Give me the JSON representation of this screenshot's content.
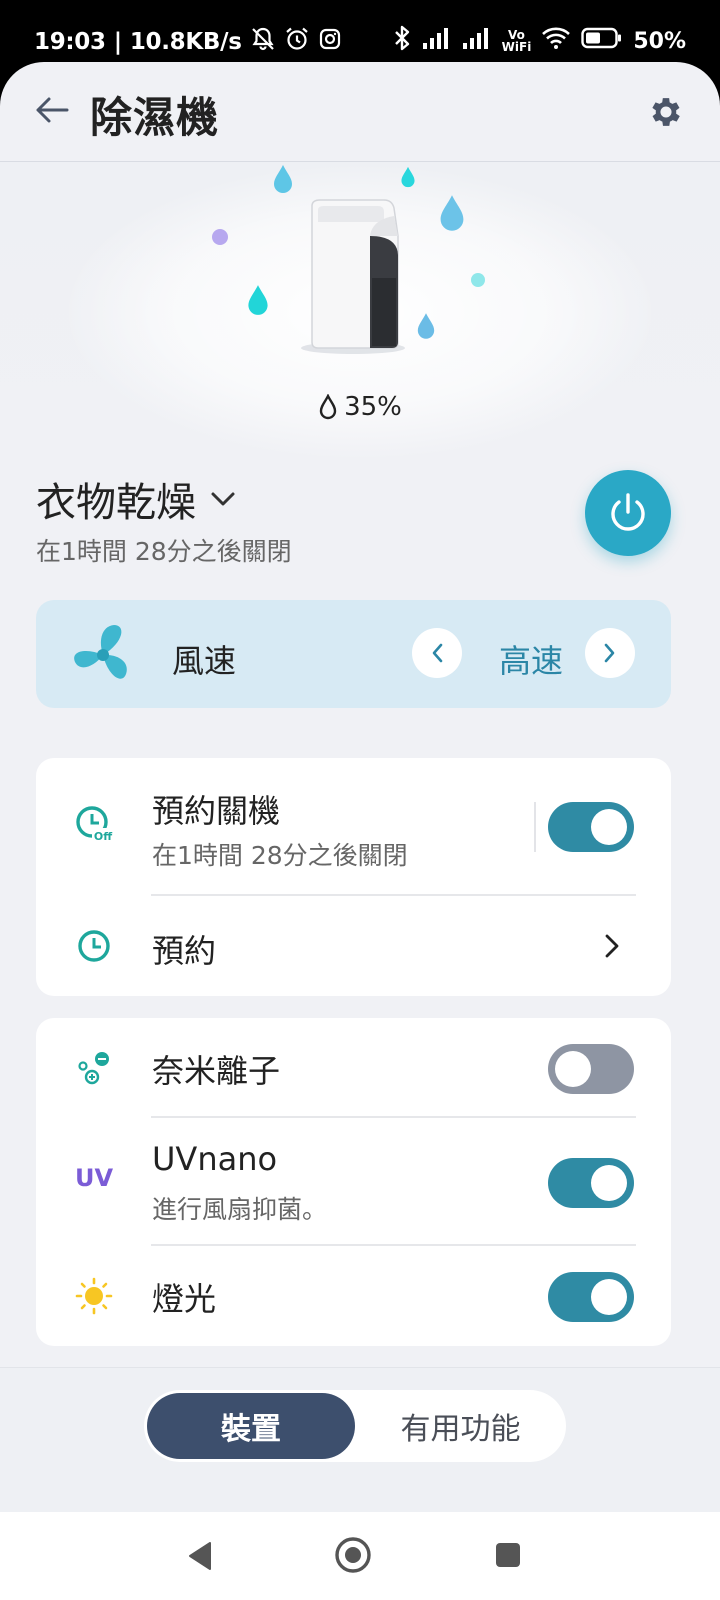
{
  "status_bar": {
    "time": "19:03",
    "separator": "|",
    "net_speed": "10.8KB/s",
    "battery": "50%",
    "icons": [
      "muted-bell-icon",
      "alarm-icon",
      "instagram-icon",
      "bluetooth-icon",
      "signal-icon",
      "signal-icon",
      "vowifi-icon",
      "wifi-icon",
      "battery-icon"
    ],
    "vowifi_top": "Vo",
    "vowifi_bottom": "WiFi"
  },
  "header": {
    "title": "除濕機",
    "back_icon": "arrow-left-icon",
    "settings_icon": "gear-icon"
  },
  "hero": {
    "humidity": "35%",
    "humidity_icon": "droplet-icon"
  },
  "mode": {
    "name": "衣物乾燥",
    "subtitle": "在1時間 28分之後關閉",
    "power_color": "#2aa8c6"
  },
  "fan": {
    "label": "風速",
    "value": "高速",
    "icon": "fan-icon"
  },
  "schedule_card": {
    "rows": [
      {
        "title": "預約關機",
        "subtitle": "在1時間 28分之後關閉",
        "icon": "timer-off-icon",
        "toggle": true
      },
      {
        "title": "預約",
        "icon": "timer-icon"
      }
    ]
  },
  "features_card": {
    "rows": [
      {
        "title": "奈米離子",
        "icon": "ion-icon",
        "toggle": false
      },
      {
        "title": "UVnano",
        "subtitle": "進行風扇抑菌。",
        "icon": "uv-icon",
        "icon_text": "UV",
        "toggle": true
      },
      {
        "title": "燈光",
        "icon": "light-icon",
        "toggle": true
      }
    ]
  },
  "tabs": {
    "active": "裝置",
    "inactive": "有用功能"
  },
  "colors": {
    "accent": "#2f8ba4",
    "toggle_off": "#8e95a3",
    "tab_active": "#3d4f6d",
    "fan_card": "#d7eaf4"
  }
}
